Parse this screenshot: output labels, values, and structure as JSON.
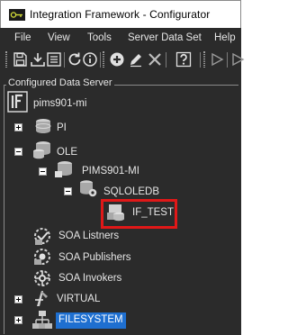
{
  "window": {
    "title": "Integration Framework - Configurator"
  },
  "menubar": {
    "items": [
      "File",
      "View",
      "Tools",
      "Server Data Set",
      "Help"
    ]
  },
  "toolbar": {
    "icons": [
      "save-icon",
      "export-icon",
      "list-icon",
      "refresh-icon",
      "info-icon",
      "add-icon",
      "edit-icon",
      "delete-icon",
      "help-icon",
      "run-icon"
    ]
  },
  "tree": {
    "panel_title": "Configured Data Server",
    "root": {
      "label": "pims901-mi"
    },
    "pi": {
      "label": "PI"
    },
    "ole": {
      "label": "OLE"
    },
    "pims": {
      "label": "PIMS901-MI"
    },
    "sqloledb": {
      "label": "SQLOLEDB"
    },
    "if_test": {
      "label": "IF_TEST"
    },
    "soa_listeners": {
      "label": "SOA Listners"
    },
    "soa_publishers": {
      "label": "SOA Publishers"
    },
    "soa_invokers": {
      "label": "SOA Invokers"
    },
    "virtual": {
      "label": "VIRTUAL"
    },
    "filesystem": {
      "label": "FILESYSTEM"
    }
  },
  "colors": {
    "background": "#2b2b2b",
    "text": "#e6e6e6",
    "selection": "#1e6fd0",
    "highlight_border": "#e01818"
  }
}
